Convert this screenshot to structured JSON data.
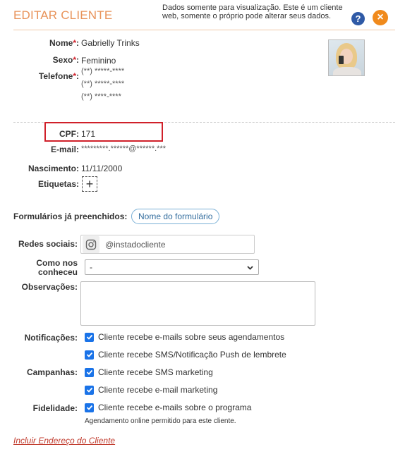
{
  "header": {
    "title": "EDITAR CLIENTE",
    "notice": "Dados somente para visualização. Este é um cliente web, somente o próprio pode alterar seus dados.",
    "help_label": "?",
    "close_label": "×"
  },
  "client": {
    "name_label": "Nome",
    "name": "Gabrielly Trinks",
    "sex_label": "Sexo",
    "sex": "Feminino",
    "phone_label": "Telefone",
    "phones": [
      "(**) *****-****",
      "(**) *****-****",
      "(**) ****-****"
    ],
    "cpf_label": "CPF:",
    "cpf": "171",
    "email_label": "E-mail:",
    "email": "*********.******@******.***",
    "birth_label": "Nascimento:",
    "birth": "11/11/2000",
    "tags_label": "Etiquetas:",
    "required_mark": "*",
    "colon": ":"
  },
  "forms": {
    "label": "Formulários já preenchidos:",
    "pill": "Nome do formulário"
  },
  "social": {
    "label": "Redes sociais:",
    "value": "@instadocliente"
  },
  "source": {
    "label_line1": "Como nos",
    "label_line2": "conheceu",
    "selected": "-"
  },
  "notes": {
    "label": "Observações:"
  },
  "notifications": {
    "label": "Notificações:",
    "options": [
      "Cliente recebe e-mails sobre seus agendamentos",
      "Cliente recebe SMS/Notificação Push de lembrete"
    ]
  },
  "campaigns": {
    "label": "Campanhas:",
    "options": [
      "Cliente recebe SMS marketing",
      "Cliente recebe e-mail marketing"
    ]
  },
  "loyalty": {
    "label": "Fidelidade:",
    "option": "Cliente recebe e-mails sobre o programa"
  },
  "online_note": "Agendamento online permitido para este cliente.",
  "address_link": "Incluir Endereço do Cliente",
  "colors": {
    "accent": "#e8935a",
    "required": "#d0202a",
    "checkbox": "#1a73e8",
    "link": "#c0392b"
  }
}
